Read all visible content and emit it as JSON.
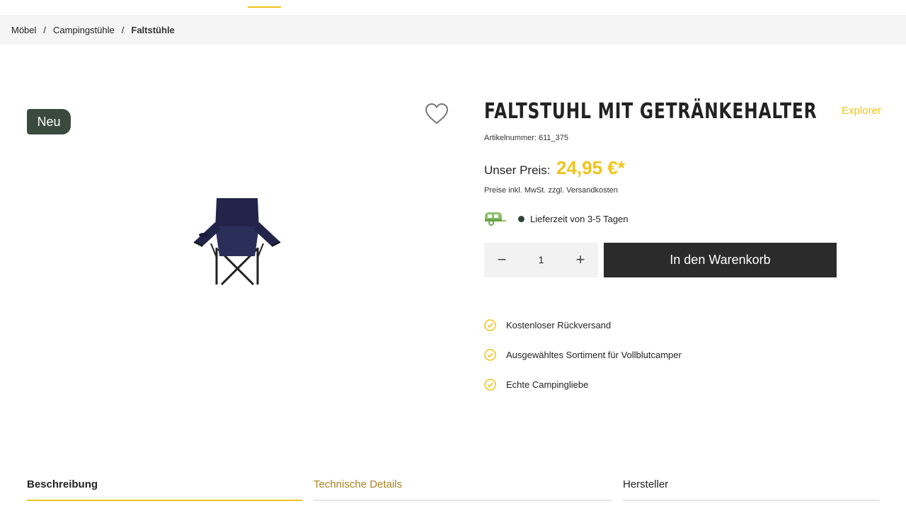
{
  "breadcrumb": {
    "items": [
      "Möbel",
      "Campingstühle",
      "Faltstühle"
    ],
    "separator": "/"
  },
  "badge": {
    "label": "Neu"
  },
  "product": {
    "title": "FALTSTUHL MIT GETRÄNKEHALTER",
    "brand": "Explorer",
    "sku": "Artikelnummer: 611_375",
    "price_label": "Unser Preis:",
    "price": "24,95 €*",
    "tax_note": "Preise inkl. MwSt. zzgl. Versandkosten",
    "delivery": "Lieferzeit von 3-5 Tagen",
    "delivery_status_color": "#2e4235"
  },
  "cart": {
    "quantity": "1",
    "minus": "−",
    "plus": "+",
    "button_label": "In den Warenkorb"
  },
  "usps": [
    "Kostenloser Rückversand",
    "Ausgewähltes Sortiment für Vollblutcamper",
    "Echte Campingliebe"
  ],
  "tabs": [
    {
      "label": "Beschreibung",
      "active": true
    },
    {
      "label": "Technische Details",
      "active": false
    },
    {
      "label": "Hersteller",
      "active": false
    }
  ],
  "colors": {
    "accent": "#f0c419",
    "dark": "#2b2b2b",
    "badge": "#3a4a3e",
    "tab_link": "#a88320"
  },
  "icons": {
    "wishlist": "heart-outline-icon",
    "delivery": "caravan-icon",
    "usp": "check-circle-icon"
  }
}
